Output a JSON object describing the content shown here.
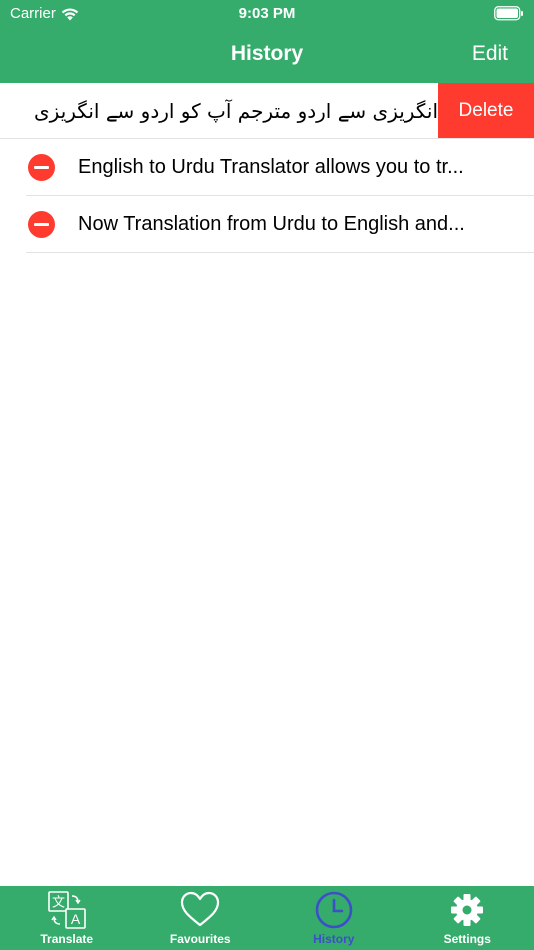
{
  "status_bar": {
    "carrier": "Carrier",
    "time": "9:03 PM"
  },
  "nav": {
    "title": "History",
    "edit_label": "Edit"
  },
  "history": {
    "swiped_item": {
      "text": "انگریزی سے اردو مترجم آپ کو اردو سے انگریزی",
      "delete_label": "Delete"
    },
    "items": [
      {
        "text": "English to Urdu Translator allows you to tr..."
      },
      {
        "text": "Now Translation from Urdu to English and..."
      }
    ]
  },
  "tabs": [
    {
      "label": "Translate",
      "icon": "translate-icon",
      "active": false
    },
    {
      "label": "Favourites",
      "icon": "heart-icon",
      "active": false
    },
    {
      "label": "History",
      "icon": "clock-icon",
      "active": true
    },
    {
      "label": "Settings",
      "icon": "gear-icon",
      "active": false
    }
  ],
  "colors": {
    "primary_green": "#35AC6C",
    "delete_red": "#FF3B30",
    "active_tab": "#3D4FC8"
  }
}
